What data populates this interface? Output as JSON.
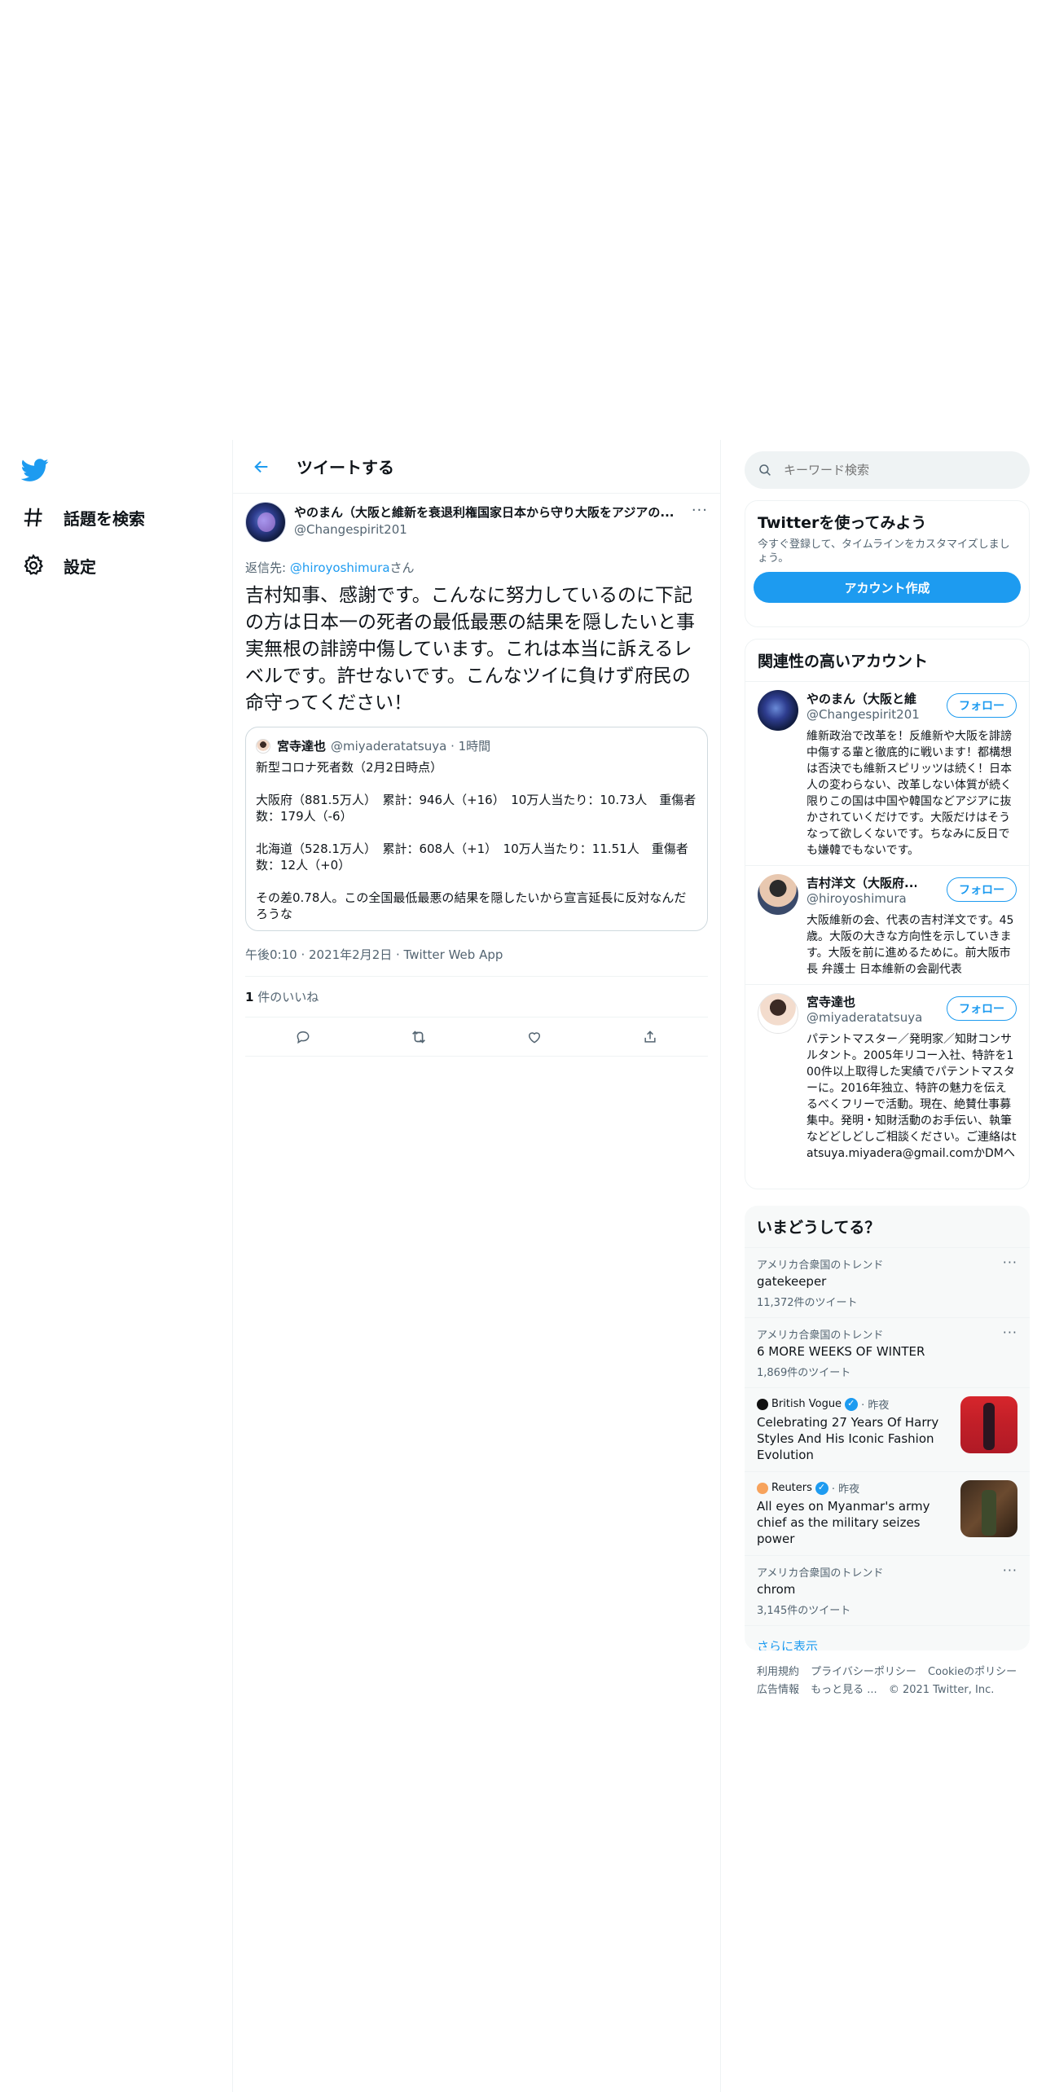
{
  "nav": {
    "items": [
      {
        "label": "話題を検索",
        "icon": "hashtag-icon"
      },
      {
        "label": "設定",
        "icon": "gear-icon"
      }
    ]
  },
  "header": {
    "title": "ツイートする"
  },
  "tweet": {
    "author_name": "やのまん（大阪と維新を衰退利権国家日本から守り大阪をアジアの...",
    "author_handle": "@Changespirit201",
    "reply_prefix": "返信先: ",
    "reply_user": "@hiroyoshimura",
    "reply_suffix": "さん",
    "text": "吉村知事、感謝です。こんなに努力しているのに下記の方は日本一の死者の最低最悪の結果を隠したいと事実無根の誹謗中傷しています。これは本当に訴えるレベルです。許せないです。こんなツイに負けず府民の命守ってください！",
    "quote": {
      "name": "宮寺達也",
      "handle": "@miyaderatatsuya · 1時間",
      "text": "新型コロナ死者数（2月2日時点）\n\n大阪府（881.5万人）　累計：946人（+16）　10万人当たり：10.73人　重傷者数：179人（-6）\n\n北海道（528.1万人）　累計：608人（+1）　10万人当たり：11.51人　重傷者数：12人（+0）\n\nその差0.78人。この全国最低最悪の結果を隠したいから宣言延長に反対なんだろうな"
    },
    "meta": "午後0:10 · 2021年2月2日 · Twitter Web App",
    "likes_count": "1",
    "likes_label": " 件のいいね"
  },
  "right": {
    "search_placeholder": "キーワード検索",
    "signup": {
      "title": "Twitterを使ってみよう",
      "desc": "今すぐ登録して、タイムラインをカスタマイズしましょう。",
      "button": "アカウント作成"
    },
    "related": {
      "title": "関連性の高いアカウント",
      "follow_label": "フォロー",
      "accounts": [
        {
          "name": "やのまん（大阪と維...",
          "handle": "@Changespirit201",
          "bio": "維新政治で改革を！反維新や大阪を誹謗中傷する輩と徹底的に戦います！都構想は否決でも維新スピリッツは続く！日本人の変わらない、改革しない体質が続く限りこの国は中国や韓国などアジアに抜かされていくだけです。大阪だけはそうなって欲しくないです。ちなみに反日でも嫌韓でもないです。"
        },
        {
          "name": "吉村洋文（大阪府...",
          "handle": "@hiroyoshimura",
          "bio": "大阪維新の会、代表の吉村洋文です。45歳。大阪の大きな方向性を示していきます。大阪を前に進めるために。前大阪市長 弁護士 日本維新の会副代表"
        },
        {
          "name": "宮寺達也",
          "handle": "@miyaderatatsuya",
          "bio": "パテントマスター／発明家／知財コンサルタント。2005年リコー入社、特許を100件以上取得した実績でパテントマスターに。2016年独立、特許の魅力を伝えるべくフリーで活動。現在、絶賛仕事募集中。発明・知財活動のお手伝い、執筆などどしどしご相談ください。ご連絡はtatsuya.miyadera@gmail.comかDMへ"
        }
      ]
    },
    "trends": {
      "title": "いまどうしてる？",
      "items": [
        {
          "context": "アメリカ合衆国のトレンド",
          "topic": "gatekeeper",
          "count": "11,372件のツイート"
        },
        {
          "context": "アメリカ合衆国のトレンド",
          "topic": "6 MORE WEEKS OF WINTER",
          "count": "1,869件のツイート"
        },
        {
          "source": "British Vogue",
          "time": "· 昨夜",
          "headline": "Celebrating 27 Years Of Harry Styles And His Iconic Fashion Evolution"
        },
        {
          "source": "Reuters",
          "time": "· 昨夜",
          "headline": "All eyes on Myanmar's army chief as the military seizes power"
        },
        {
          "context": "アメリカ合衆国のトレンド",
          "topic": "chrom",
          "count": "3,145件のツイート"
        }
      ],
      "show_more": "さらに表示"
    },
    "footer": {
      "links": [
        "利用規約",
        "プライバシーポリシー",
        "Cookieのポリシー",
        "広告情報",
        "もっと見る ..."
      ],
      "copyright": "© 2021 Twitter, Inc."
    }
  },
  "colors": {
    "accent": "#1d9bf0",
    "text": "#0f1419",
    "muted": "#536471"
  }
}
